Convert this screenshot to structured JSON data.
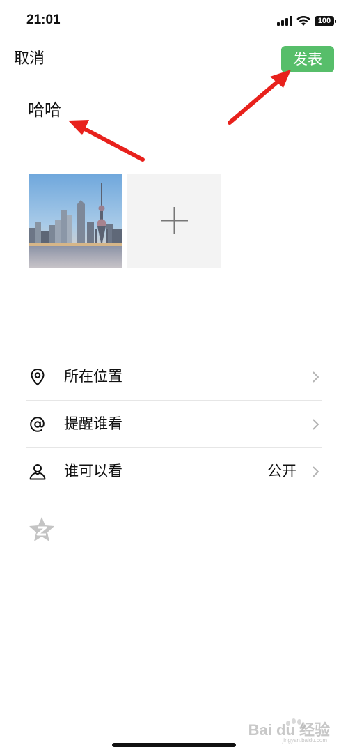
{
  "status_bar": {
    "time": "21:01",
    "battery": "100"
  },
  "nav": {
    "cancel_label": "取消",
    "publish_label": "发表"
  },
  "post": {
    "text": "哈哈"
  },
  "photos": {
    "count": 1,
    "add_icon": "plus-icon"
  },
  "options": [
    {
      "icon": "location-pin-icon",
      "label": "所在位置",
      "value": ""
    },
    {
      "icon": "at-sign-icon",
      "label": "提醒谁看",
      "value": ""
    },
    {
      "icon": "person-icon",
      "label": "谁可以看",
      "value": "公开"
    }
  ],
  "extra": {
    "qzone_icon": "qzone-star-icon"
  },
  "watermark": {
    "text": "Bai du 经验",
    "sub": "jingyan.baidu.com"
  },
  "colors": {
    "publish_button": "#57be6a",
    "annotation_arrow": "#e8211c",
    "add_tile_background": "#f3f3f3"
  }
}
